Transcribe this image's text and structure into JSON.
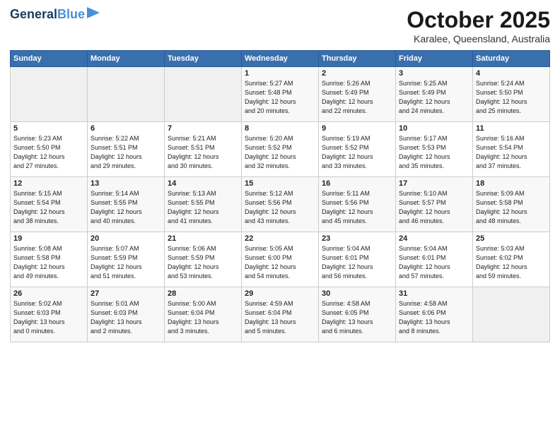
{
  "logo": {
    "line1": "General",
    "line2": "Blue"
  },
  "title": "October 2025",
  "subtitle": "Karalee, Queensland, Australia",
  "weekdays": [
    "Sunday",
    "Monday",
    "Tuesday",
    "Wednesday",
    "Thursday",
    "Friday",
    "Saturday"
  ],
  "weeks": [
    [
      {
        "day": "",
        "info": ""
      },
      {
        "day": "",
        "info": ""
      },
      {
        "day": "",
        "info": ""
      },
      {
        "day": "1",
        "info": "Sunrise: 5:27 AM\nSunset: 5:48 PM\nDaylight: 12 hours\nand 20 minutes."
      },
      {
        "day": "2",
        "info": "Sunrise: 5:26 AM\nSunset: 5:49 PM\nDaylight: 12 hours\nand 22 minutes."
      },
      {
        "day": "3",
        "info": "Sunrise: 5:25 AM\nSunset: 5:49 PM\nDaylight: 12 hours\nand 24 minutes."
      },
      {
        "day": "4",
        "info": "Sunrise: 5:24 AM\nSunset: 5:50 PM\nDaylight: 12 hours\nand 25 minutes."
      }
    ],
    [
      {
        "day": "5",
        "info": "Sunrise: 5:23 AM\nSunset: 5:50 PM\nDaylight: 12 hours\nand 27 minutes."
      },
      {
        "day": "6",
        "info": "Sunrise: 5:22 AM\nSunset: 5:51 PM\nDaylight: 12 hours\nand 29 minutes."
      },
      {
        "day": "7",
        "info": "Sunrise: 5:21 AM\nSunset: 5:51 PM\nDaylight: 12 hours\nand 30 minutes."
      },
      {
        "day": "8",
        "info": "Sunrise: 5:20 AM\nSunset: 5:52 PM\nDaylight: 12 hours\nand 32 minutes."
      },
      {
        "day": "9",
        "info": "Sunrise: 5:19 AM\nSunset: 5:52 PM\nDaylight: 12 hours\nand 33 minutes."
      },
      {
        "day": "10",
        "info": "Sunrise: 5:17 AM\nSunset: 5:53 PM\nDaylight: 12 hours\nand 35 minutes."
      },
      {
        "day": "11",
        "info": "Sunrise: 5:16 AM\nSunset: 5:54 PM\nDaylight: 12 hours\nand 37 minutes."
      }
    ],
    [
      {
        "day": "12",
        "info": "Sunrise: 5:15 AM\nSunset: 5:54 PM\nDaylight: 12 hours\nand 38 minutes."
      },
      {
        "day": "13",
        "info": "Sunrise: 5:14 AM\nSunset: 5:55 PM\nDaylight: 12 hours\nand 40 minutes."
      },
      {
        "day": "14",
        "info": "Sunrise: 5:13 AM\nSunset: 5:55 PM\nDaylight: 12 hours\nand 41 minutes."
      },
      {
        "day": "15",
        "info": "Sunrise: 5:12 AM\nSunset: 5:56 PM\nDaylight: 12 hours\nand 43 minutes."
      },
      {
        "day": "16",
        "info": "Sunrise: 5:11 AM\nSunset: 5:56 PM\nDaylight: 12 hours\nand 45 minutes."
      },
      {
        "day": "17",
        "info": "Sunrise: 5:10 AM\nSunset: 5:57 PM\nDaylight: 12 hours\nand 46 minutes."
      },
      {
        "day": "18",
        "info": "Sunrise: 5:09 AM\nSunset: 5:58 PM\nDaylight: 12 hours\nand 48 minutes."
      }
    ],
    [
      {
        "day": "19",
        "info": "Sunrise: 5:08 AM\nSunset: 5:58 PM\nDaylight: 12 hours\nand 49 minutes."
      },
      {
        "day": "20",
        "info": "Sunrise: 5:07 AM\nSunset: 5:59 PM\nDaylight: 12 hours\nand 51 minutes."
      },
      {
        "day": "21",
        "info": "Sunrise: 5:06 AM\nSunset: 5:59 PM\nDaylight: 12 hours\nand 53 minutes."
      },
      {
        "day": "22",
        "info": "Sunrise: 5:05 AM\nSunset: 6:00 PM\nDaylight: 12 hours\nand 54 minutes."
      },
      {
        "day": "23",
        "info": "Sunrise: 5:04 AM\nSunset: 6:01 PM\nDaylight: 12 hours\nand 56 minutes."
      },
      {
        "day": "24",
        "info": "Sunrise: 5:04 AM\nSunset: 6:01 PM\nDaylight: 12 hours\nand 57 minutes."
      },
      {
        "day": "25",
        "info": "Sunrise: 5:03 AM\nSunset: 6:02 PM\nDaylight: 12 hours\nand 59 minutes."
      }
    ],
    [
      {
        "day": "26",
        "info": "Sunrise: 5:02 AM\nSunset: 6:03 PM\nDaylight: 13 hours\nand 0 minutes."
      },
      {
        "day": "27",
        "info": "Sunrise: 5:01 AM\nSunset: 6:03 PM\nDaylight: 13 hours\nand 2 minutes."
      },
      {
        "day": "28",
        "info": "Sunrise: 5:00 AM\nSunset: 6:04 PM\nDaylight: 13 hours\nand 3 minutes."
      },
      {
        "day": "29",
        "info": "Sunrise: 4:59 AM\nSunset: 6:04 PM\nDaylight: 13 hours\nand 5 minutes."
      },
      {
        "day": "30",
        "info": "Sunrise: 4:58 AM\nSunset: 6:05 PM\nDaylight: 13 hours\nand 6 minutes."
      },
      {
        "day": "31",
        "info": "Sunrise: 4:58 AM\nSunset: 6:06 PM\nDaylight: 13 hours\nand 8 minutes."
      },
      {
        "day": "",
        "info": ""
      }
    ]
  ]
}
